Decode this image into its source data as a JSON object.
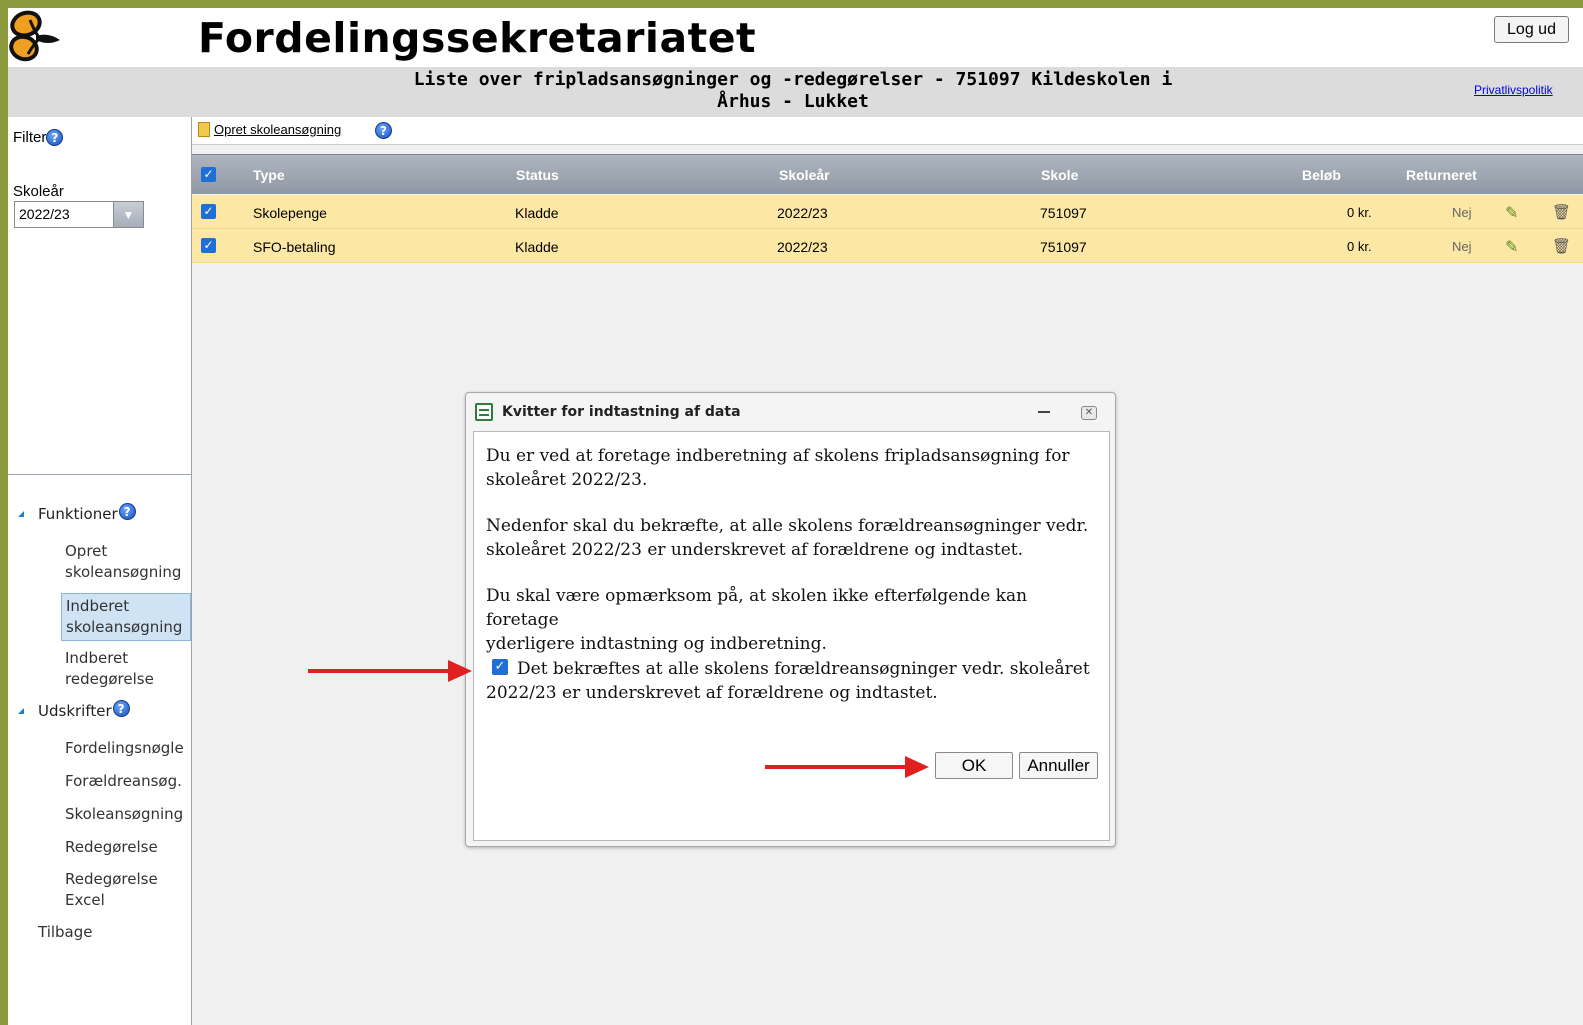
{
  "header": {
    "title": "Fordelingssekretariatet",
    "logout_label": "Log ud",
    "subtitle_line1": "Liste over fripladsansøgninger og -redegørelser - 751097 Kildeskolen i",
    "subtitle_line2": "Århus - Lukket",
    "privacy_link": "Privatlivspolitik"
  },
  "sidebar": {
    "filter_label": "Filter",
    "skoleaar_label": "Skoleår",
    "skoleaar_value": "2022/23",
    "groups": {
      "funktioner": "Funktioner",
      "udskrifter": "Udskrifter"
    },
    "funktioner_items": [
      {
        "line1": "Opret",
        "line2": "skoleansøgning"
      },
      {
        "line1": "Indberet",
        "line2": "skoleansøgning"
      },
      {
        "line1": "Indberet",
        "line2": "redegørelse"
      }
    ],
    "udskrifter_items": [
      {
        "line1": "Fordelingsnøgle"
      },
      {
        "line1": "Forældreansøg."
      },
      {
        "line1": "Skoleansøgning"
      },
      {
        "line1": "Redegørelse"
      },
      {
        "line1": "Redegørelse",
        "line2": "Excel"
      }
    ],
    "back_label": "Tilbage"
  },
  "toolbar": {
    "create_link": "Opret skoleansøgning"
  },
  "table": {
    "headers": {
      "type": "Type",
      "status": "Status",
      "skoleaar": "Skoleår",
      "skole": "Skole",
      "beloeb": "Beløb",
      "returneret": "Returneret"
    },
    "rows": [
      {
        "type": "Skolepenge",
        "status": "Kladde",
        "skoleaar": "2022/23",
        "skole": "751097",
        "beloeb": "0 kr.",
        "returneret": "Nej",
        "checked": true
      },
      {
        "type": "SFO-betaling",
        "status": "Kladde",
        "skoleaar": "2022/23",
        "skole": "751097",
        "beloeb": "0 kr.",
        "returneret": "Nej",
        "checked": true
      }
    ]
  },
  "dialog": {
    "title": "Kvitter for indtastning af data",
    "para1_line1": "Du er ved at foretage indberetning af skolens fripladsansøgning for",
    "para1_line2": "skoleåret 2022/23.",
    "para2_line1": "Nedenfor skal du bekræfte, at alle skolens forældreansøgninger vedr.",
    "para2_line2": "skoleåret 2022/23 er underskrevet af forældrene og indtastet.",
    "para3_line1": "Du skal være opmærksom på, at skolen ikke efterfølgende kan foretage",
    "para3_line2": "yderligere indtastning og indberetning.",
    "confirm_line1": "Det bekræftes at alle skolens forældreansøgninger vedr. skoleåret",
    "confirm_line2": "2022/23 er underskrevet af forældrene og indtastet.",
    "confirm_checked": true,
    "ok_label": "OK",
    "cancel_label": "Annuller"
  },
  "colors": {
    "row_bg": "#fde7a4",
    "arrow": "#e0201f",
    "checkbox": "#1f6fd6",
    "frame": "#8a9a3c"
  }
}
